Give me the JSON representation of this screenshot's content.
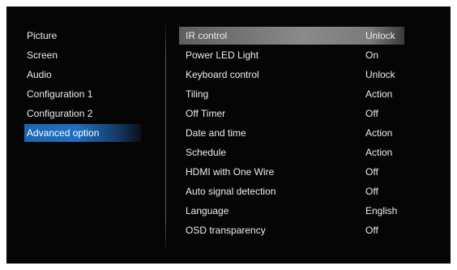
{
  "left_menu": {
    "items": [
      {
        "label": "Picture"
      },
      {
        "label": "Screen"
      },
      {
        "label": "Audio"
      },
      {
        "label": "Configuration 1"
      },
      {
        "label": "Configuration 2"
      },
      {
        "label": "Advanced option",
        "selected": true
      }
    ]
  },
  "right_menu": {
    "rows": [
      {
        "label": "IR control",
        "value": "Unlock",
        "selected": true
      },
      {
        "label": "Power LED Light",
        "value": "On"
      },
      {
        "label": "Keyboard control",
        "value": "Unlock"
      },
      {
        "label": "Tiling",
        "value": "Action"
      },
      {
        "label": "Off Timer",
        "value": "Off"
      },
      {
        "label": "Date and time",
        "value": "Action"
      },
      {
        "label": "Schedule",
        "value": "Action"
      },
      {
        "label": "HDMI with One Wire",
        "value": "Off"
      },
      {
        "label": "Auto signal detection",
        "value": "Off"
      },
      {
        "label": "Language",
        "value": "English"
      },
      {
        "label": "OSD transparency",
        "value": "Off"
      }
    ]
  },
  "colors": {
    "background": "#050505",
    "text": "#ececec",
    "selected_left": "#1f6fc2",
    "selected_right": "#8a8a8a"
  }
}
